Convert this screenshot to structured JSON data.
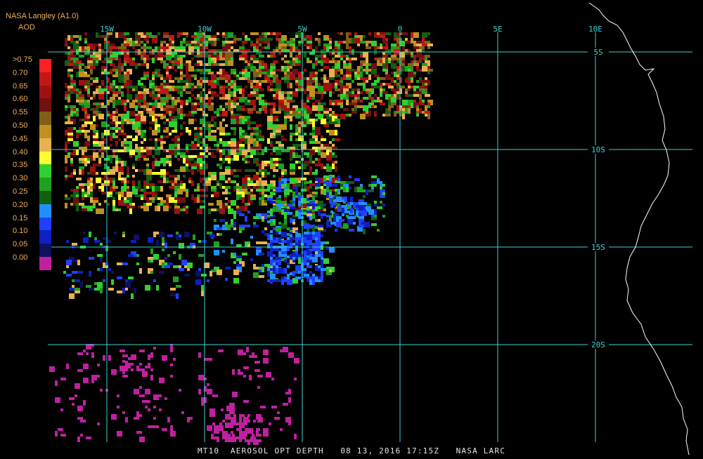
{
  "header": {
    "title": "NASA Langley (A1.0)",
    "subtitle": "AOD"
  },
  "legend": {
    "items": [
      {
        "label": ">0.75",
        "color": "#ff2020"
      },
      {
        "label": "0.70",
        "color": "#c01818"
      },
      {
        "label": "0.65",
        "color": "#a01010"
      },
      {
        "label": "0.60",
        "color": "#701010"
      },
      {
        "label": "0.55",
        "color": "#806018"
      },
      {
        "label": "0.50",
        "color": "#c09020"
      },
      {
        "label": "0.45",
        "color": "#e8b050"
      },
      {
        "label": "0.40",
        "color": "#ffff30"
      },
      {
        "label": "0.35",
        "color": "#30d030"
      },
      {
        "label": "0.30",
        "color": "#20a020"
      },
      {
        "label": "0.25",
        "color": "#106010"
      },
      {
        "label": "0.20",
        "color": "#2090ff"
      },
      {
        "label": "0.15",
        "color": "#2040ff"
      },
      {
        "label": "0.10",
        "color": "#1020c0"
      },
      {
        "label": "0.05",
        "color": "#101060"
      },
      {
        "label": "0.00",
        "color": "#c020a0"
      }
    ]
  },
  "grid": {
    "color": "#40d0d0",
    "lon_labels": [
      "15W",
      "10W",
      "5W",
      "0",
      "5E",
      "10E"
    ],
    "lat_labels": [
      "5S",
      "10S",
      "15S",
      "20S"
    ]
  },
  "footer": {
    "text": "MT10  AEROSOL OPT DEPTH   08 13, 2016 17:15Z   NASA LARC"
  },
  "coastline_color": "#ffffff"
}
